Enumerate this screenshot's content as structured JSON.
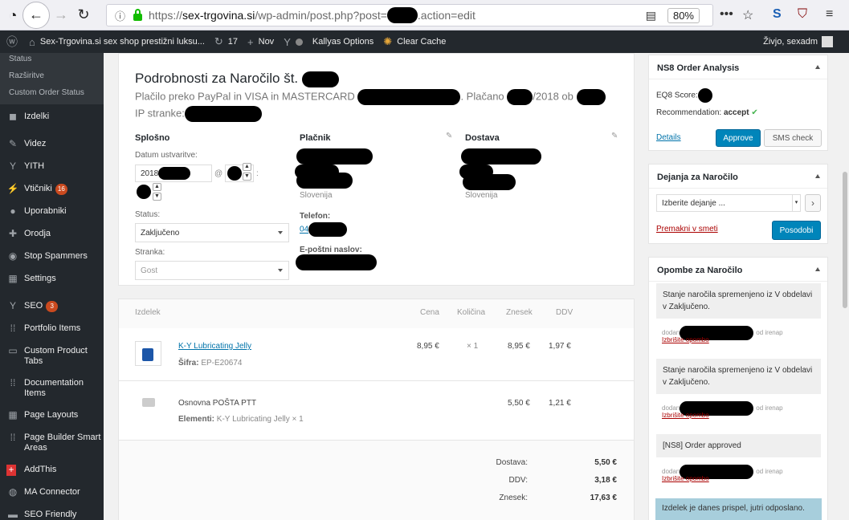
{
  "browser": {
    "url_prefix": "https://",
    "url_host": "sex-trgovina.si",
    "url_path": "/wp-admin/post.php?post=",
    "url_suffix": ".action=edit",
    "zoom": "80%"
  },
  "adminbar": {
    "site": "Sex-Trgovina.si sex shop prestižni luksu...",
    "updates": "17",
    "new": "Nov",
    "kallyas": "Kallyas Options",
    "cache": "Clear Cache",
    "greeting": "Živjo, sexadm"
  },
  "sidebar": {
    "sub": [
      "Status",
      "Razširitve",
      "Custom Order Status"
    ],
    "items": [
      {
        "label": "Izdelki",
        "icon": "products-icon"
      },
      {
        "label": "Videz",
        "icon": "appearance-icon"
      },
      {
        "label": "YITH",
        "icon": "yith-icon"
      },
      {
        "label": "Vtičniki",
        "icon": "plugins-icon",
        "badge": "16"
      },
      {
        "label": "Uporabniki",
        "icon": "users-icon"
      },
      {
        "label": "Orodja",
        "icon": "tools-icon"
      },
      {
        "label": "Stop Spammers",
        "icon": "stop-icon"
      },
      {
        "label": "Settings",
        "icon": "settings-icon"
      },
      {
        "label": "SEO",
        "icon": "seo-icon",
        "badge": "3"
      },
      {
        "label": "Portfolio Items",
        "icon": "grid-icon"
      },
      {
        "label": "Custom Product Tabs",
        "icon": "tabs-icon"
      },
      {
        "label": "Documentation Items",
        "icon": "grid-icon"
      },
      {
        "label": "Page Layouts",
        "icon": "layout-icon"
      },
      {
        "label": "Page Builder Smart Areas",
        "icon": "grid-icon"
      },
      {
        "label": "AddThis",
        "icon": "plus-icon"
      },
      {
        "label": "MA Connector",
        "icon": "connector-icon"
      },
      {
        "label": "SEO Friendly Images",
        "icon": "images-icon"
      }
    ]
  },
  "order": {
    "title": "Podrobnosti za Naročilo št.",
    "payment_prefix": "Plačilo preko PayPal in VISA in MASTERCARD",
    "paid": ". Plačano",
    "paid_year": "/2018 ob",
    "ip": "IP stranke:",
    "general": "Splošno",
    "created_label": "Datum ustvaritve:",
    "created_value": "2018",
    "at": "@",
    "colon": ":",
    "status_label": "Status:",
    "status_value": "Zaključeno",
    "customer_label": "Stranka:",
    "customer_value": "Gost",
    "billing": "Plačnik",
    "billing_country": "Slovenija",
    "phone_label": "Telefon:",
    "phone_value": "04",
    "email_label": "E-poštni naslov:",
    "shipping": "Dostava",
    "shipping_country": "Slovenija"
  },
  "items": {
    "headers": {
      "item": "Izdelek",
      "price": "Cena",
      "qty": "Količina",
      "total": "Znesek",
      "tax": "DDV"
    },
    "product": {
      "name": "K-Y Lubricating Jelly",
      "sku_label": "Šifra:",
      "sku": "EP-E20674",
      "price": "8,95 €",
      "qty": "× 1",
      "total": "8,95 €",
      "tax": "1,97 €"
    },
    "shipping": {
      "name": "Osnovna POŠTA PTT",
      "items_label": "Elementi:",
      "items": "K-Y Lubricating Jelly × 1",
      "total": "5,50 €",
      "tax": "1,21 €"
    },
    "totals": [
      {
        "label": "Dostava:",
        "value": "5,50 €"
      },
      {
        "label": "DDV:",
        "value": "3,18 €"
      },
      {
        "label": "Znesek:",
        "value": "17,63 €"
      }
    ]
  },
  "ns8": {
    "title": "NS8 Order Analysis",
    "score_label": "EQ8 Score:",
    "rec_label": "Recommendation:",
    "rec_value": "accept",
    "details": "Details",
    "approve": "Approve",
    "sms": "SMS check"
  },
  "actions": {
    "title": "Dejanja za Naročilo",
    "select": "Izberite dejanje ...",
    "trash": "Premakni v smeti",
    "update": "Posodobi"
  },
  "notes": {
    "title": "Opombe za Naročilo",
    "list": [
      {
        "text": "Stanje naročila spremenjeno iz V obdelavi v Zaključeno.",
        "meta_a": "dodan",
        "meta_b": "od irenap",
        "del": "Izbrišite opombo"
      },
      {
        "text": "Stanje naročila spremenjeno iz V obdelavi v Zaključeno.",
        "meta_a": "dodan",
        "meta_b": "od irenap",
        "del": "Izbrišite opombo"
      },
      {
        "text": "[NS8] Order approved",
        "meta_a": "dodan",
        "meta_b": "od irenap",
        "del": "Izbrišite opombo"
      }
    ],
    "customer_note": "Izdelek je danes prispel, jutri odposlano."
  },
  "colors": {
    "accent": "#0085ba",
    "adminbar": "#23282d",
    "success": "#46b450",
    "danger": "#a00"
  }
}
